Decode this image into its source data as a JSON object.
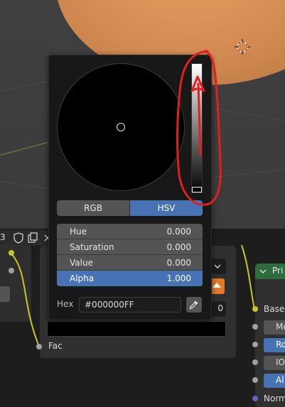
{
  "picker": {
    "modes": {
      "rgb": "RGB",
      "hsv": "HSV",
      "active": "HSV"
    },
    "fields": [
      {
        "label": "Hue",
        "value": "0.000"
      },
      {
        "label": "Saturation",
        "value": "0.000"
      },
      {
        "label": "Value",
        "value": "0.000"
      },
      {
        "label": "Alpha",
        "value": "1.000"
      }
    ],
    "hex": {
      "label": "Hex",
      "value": "#000000FF"
    },
    "value_level": 0.0
  },
  "node_editor": {
    "tab_number": "3",
    "fac_label": "Fac",
    "partial_value": "0",
    "base_label": "Base",
    "right_labels": [
      "Pri",
      "Me",
      "Ro",
      "IO",
      "Al",
      "Norm"
    ]
  },
  "colors": {
    "accent_blue": "#4772b3",
    "annotation_red": "#e02020",
    "socket_yellow": "#c7c729",
    "socket_gray": "#a1a1a1",
    "socket_purple": "#6363c7",
    "node_header_green": "#2f6c3d"
  }
}
